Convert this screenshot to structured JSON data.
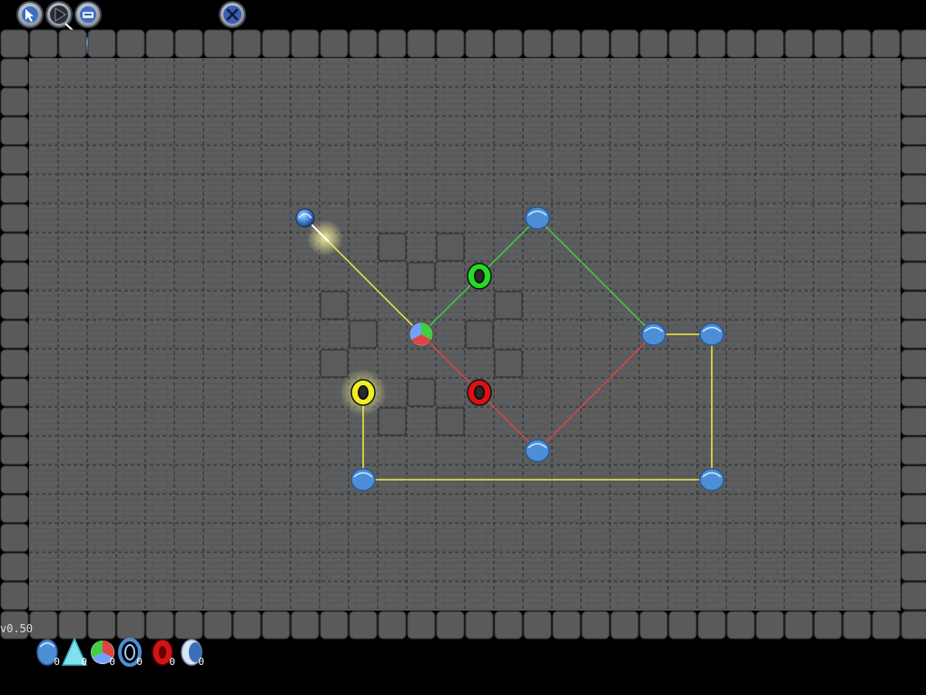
{
  "version": "v0.50",
  "toolbar": {
    "tools": [
      {
        "name": "select-tool",
        "icon": "cursor-arrow-icon"
      },
      {
        "name": "play-tool",
        "icon": "play-triangle-icon"
      },
      {
        "name": "save-tool",
        "icon": "disk-icon"
      }
    ],
    "close_icon": "close-x-icon"
  },
  "board": {
    "cols": 30,
    "rows": 19,
    "floor_color": "#5d5e60",
    "wall_color": "#5a5a5a",
    "grid_line_color": "#2a2a2a"
  },
  "beam_colors": {
    "white": "#ffffff",
    "yellow": "#f2ee3c",
    "green": "#44cc44",
    "red": "#dd4444",
    "blue": "#6ab0ff"
  },
  "pieces": {
    "emitter": {
      "col": 9,
      "row": 5,
      "direction": "south-east"
    },
    "splitter": {
      "col": 13,
      "row": 9
    },
    "mirrors": [
      {
        "col": 17,
        "row": 5
      },
      {
        "col": 21,
        "row": 9
      },
      {
        "col": 23,
        "row": 9
      },
      {
        "col": 17,
        "row": 13
      },
      {
        "col": 11,
        "row": 14
      },
      {
        "col": 23,
        "row": 14
      }
    ],
    "targets": [
      {
        "col": 15,
        "row": 7,
        "color": "#22dd22",
        "lit": false
      },
      {
        "col": 15,
        "row": 11,
        "color": "#dd1111",
        "lit": false
      },
      {
        "col": 11,
        "row": 11,
        "color": "#eeee22",
        "lit": true
      }
    ],
    "blocks": [
      {
        "col": 12,
        "row": 6
      },
      {
        "col": 14,
        "row": 6
      },
      {
        "col": 13,
        "row": 7
      },
      {
        "col": 10,
        "row": 8
      },
      {
        "col": 16,
        "row": 8
      },
      {
        "col": 11,
        "row": 9
      },
      {
        "col": 15,
        "row": 9
      },
      {
        "col": 10,
        "row": 10
      },
      {
        "col": 16,
        "row": 10
      },
      {
        "col": 13,
        "row": 11
      },
      {
        "col": 12,
        "row": 12
      },
      {
        "col": 14,
        "row": 12
      }
    ]
  },
  "inventory": [
    {
      "name": "mirror",
      "icon": "mirror-drop-icon",
      "count": "0"
    },
    {
      "name": "prism",
      "icon": "prism-cone-icon",
      "count": "0"
    },
    {
      "name": "splitter",
      "icon": "tricolor-splitter-icon",
      "count": "0"
    },
    {
      "name": "portal",
      "icon": "ring-portal-icon",
      "count": "0"
    },
    {
      "name": "filter",
      "icon": "red-filter-icon",
      "count": "0"
    },
    {
      "name": "lens",
      "icon": "crescent-lens-icon",
      "count": "0"
    }
  ]
}
